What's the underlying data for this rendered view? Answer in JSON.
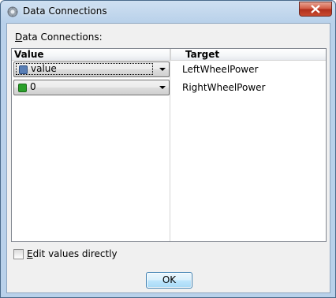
{
  "window": {
    "title": "Data Connections"
  },
  "main": {
    "section_label": "Data Connections:",
    "section_label_accesskey": "D",
    "section_label_rest": "ata Connections:",
    "columns": [
      "Value",
      "Target"
    ],
    "rows": [
      {
        "value": "value",
        "value_icon": "blue-cube-icon",
        "target": "LeftWheelPower"
      },
      {
        "value": "0",
        "value_icon": "green-cube-icon",
        "target": "RightWheelPower"
      }
    ],
    "checkbox": {
      "label": "Edit values directly",
      "accesskey": "E",
      "label_rest": "dit values directly",
      "checked": false
    },
    "ok_button": "OK"
  },
  "colors": {
    "value_icon_blue": "#5a7fb5",
    "value_icon_green": "#2aa02a",
    "close_button": "#c94a2f"
  }
}
